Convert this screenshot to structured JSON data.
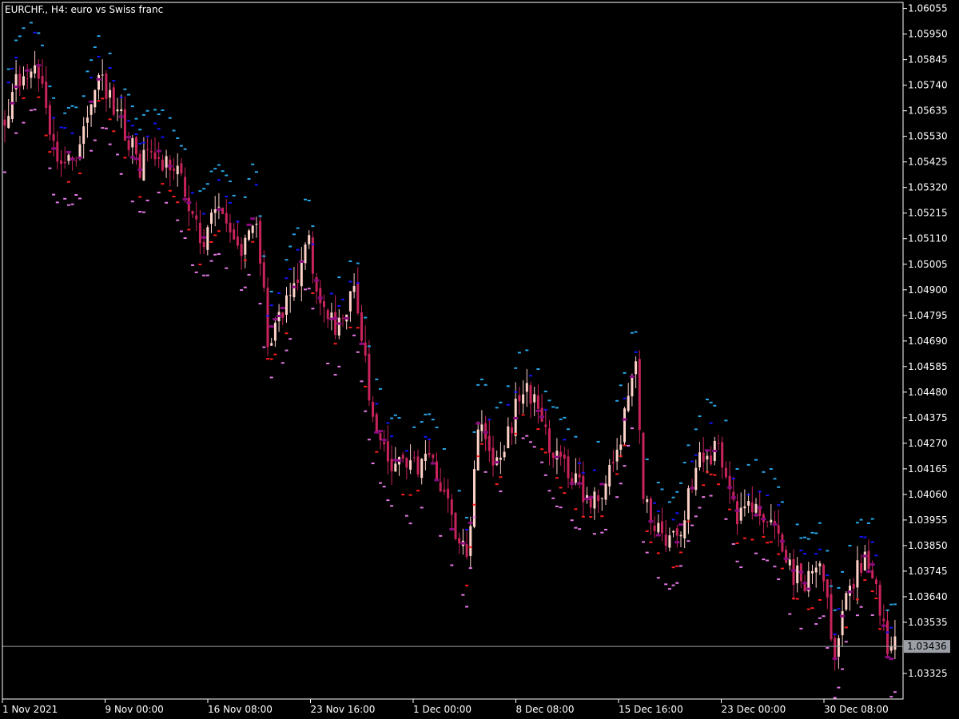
{
  "chart_data": {
    "type": "candlestick",
    "title": "EURCHF., H4:  euro vs Swiss franc",
    "ylim": [
      1.0322,
      1.0608
    ],
    "y_ticks": [
      "1.06055",
      "1.05950",
      "1.05845",
      "1.05740",
      "1.05635",
      "1.05530",
      "1.05425",
      "1.05320",
      "1.05215",
      "1.05110",
      "1.05005",
      "1.04900",
      "1.04795",
      "1.04690",
      "1.04585",
      "1.04480",
      "1.04375",
      "1.04270",
      "1.04165",
      "1.04060",
      "1.03955",
      "1.03850",
      "1.03745",
      "1.03640",
      "1.03535",
      "1.03325"
    ],
    "x_ticks": [
      "1 Nov 2021",
      "9 Nov 00:00",
      "16 Nov 08:00",
      "23 Nov 16:00",
      "1 Dec 00:00",
      "8 Dec 08:00",
      "15 Dec 16:00",
      "23 Dec 00:00",
      "30 Dec 08:00"
    ],
    "current_price": 1.03436,
    "current_price_label": "1.03436",
    "colors": {
      "background": "#000000",
      "axis": "#ffffff",
      "bull_candle": "#ffd2c8",
      "bear_candle": "#c8245a",
      "marker_sky": "#29a6e6",
      "marker_blue": "#1414ff",
      "marker_red": "#ff1e1e",
      "marker_purple": "#8c0a82",
      "marker_pink": "#e678e6",
      "price_line": "#9aa0a6",
      "price_label_bg": "#9aa0a6"
    },
    "anchors": [
      [
        0,
        1.0553
      ],
      [
        20,
        1.0575
      ],
      [
        45,
        1.0585
      ],
      [
        70,
        1.0545
      ],
      [
        100,
        1.0547
      ],
      [
        125,
        1.058
      ],
      [
        150,
        1.056
      ],
      [
        175,
        1.054
      ],
      [
        195,
        1.0548
      ],
      [
        225,
        1.0535
      ],
      [
        250,
        1.051
      ],
      [
        275,
        1.0525
      ],
      [
        300,
        1.0505
      ],
      [
        320,
        1.0525
      ],
      [
        335,
        1.047
      ],
      [
        360,
        1.0485
      ],
      [
        385,
        1.051
      ],
      [
        405,
        1.048
      ],
      [
        425,
        1.0475
      ],
      [
        445,
        1.049
      ],
      [
        465,
        1.044
      ],
      [
        490,
        1.042
      ],
      [
        515,
        1.0415
      ],
      [
        540,
        1.042
      ],
      [
        565,
        1.0395
      ],
      [
        585,
        1.038
      ],
      [
        600,
        1.044
      ],
      [
        620,
        1.042
      ],
      [
        640,
        1.0435
      ],
      [
        655,
        1.045
      ],
      [
        670,
        1.0445
      ],
      [
        690,
        1.0425
      ],
      [
        710,
        1.0415
      ],
      [
        735,
        1.0405
      ],
      [
        760,
        1.041
      ],
      [
        780,
        1.0435
      ],
      [
        795,
        1.046
      ],
      [
        805,
        1.0405
      ],
      [
        825,
        1.039
      ],
      [
        845,
        1.0385
      ],
      [
        865,
        1.041
      ],
      [
        885,
        1.0425
      ],
      [
        905,
        1.042
      ],
      [
        925,
        1.0395
      ],
      [
        945,
        1.04
      ],
      [
        970,
        1.0395
      ],
      [
        990,
        1.0375
      ],
      [
        1010,
        1.037
      ],
      [
        1030,
        1.0375
      ],
      [
        1045,
        1.034
      ],
      [
        1060,
        1.0365
      ],
      [
        1080,
        1.038
      ],
      [
        1095,
        1.0375
      ],
      [
        1110,
        1.034
      ],
      [
        1125,
        1.0345
      ]
    ]
  }
}
